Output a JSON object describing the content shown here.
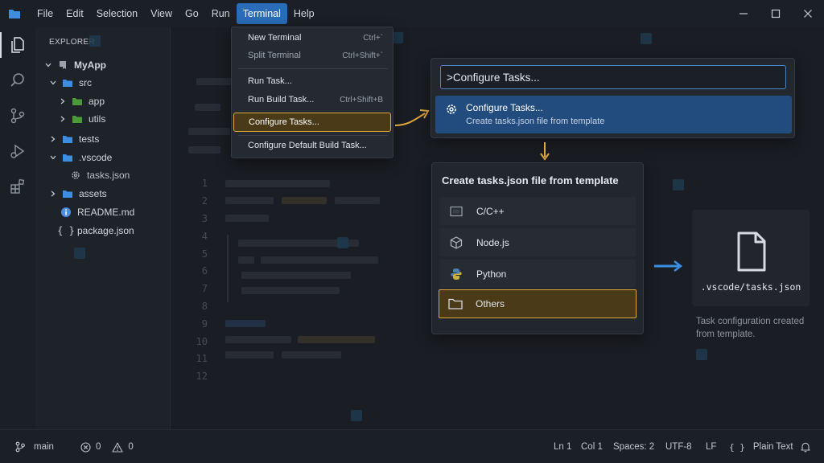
{
  "menubar": {
    "items": [
      "File",
      "Edit",
      "Selection",
      "View",
      "Go",
      "Run",
      "Terminal",
      "Help"
    ],
    "active": "Terminal"
  },
  "sidebar": {
    "header": "EXPLORER",
    "tree": [
      {
        "label": "MyApp",
        "icon": "repo-icon",
        "expanded": true
      },
      {
        "label": "src",
        "icon": "folder-icon",
        "expanded": true
      },
      {
        "label": "app",
        "icon": "folder-icon",
        "expanded": false
      },
      {
        "label": "utils",
        "icon": "folder-icon",
        "expanded": false
      },
      {
        "label": "tests",
        "icon": "folder-icon",
        "expanded": false
      },
      {
        "label": ".vscode",
        "icon": "folder-icon",
        "expanded": true
      },
      {
        "label": "tasks.json",
        "icon": "gear-icon"
      },
      {
        "label": "assets",
        "icon": "folder-icon",
        "expanded": false
      },
      {
        "label": "README.md",
        "icon": "info-icon"
      },
      {
        "label": "package.json",
        "icon": "braces-icon"
      }
    ]
  },
  "editor": {
    "line_numbers": [
      "1",
      "2",
      "3",
      "4",
      "5",
      "6",
      "7",
      "8",
      "9",
      "10",
      "11",
      "12"
    ]
  },
  "terminal_menu": {
    "items": [
      {
        "label": "New Terminal",
        "shortcut": "Ctrl+`"
      },
      {
        "label": "Split Terminal",
        "shortcut": "Ctrl+Shift+`"
      },
      {
        "label": "Run Task...",
        "shortcut": ""
      },
      {
        "label": "Run Build Task...",
        "shortcut": "Ctrl+Shift+B"
      },
      {
        "label": "Configure Tasks...",
        "shortcut": ""
      },
      {
        "label": "Configure Default Build Task...",
        "shortcut": ""
      }
    ]
  },
  "command_palette": {
    "input_value": ">Configure Tasks...",
    "result_title": "Configure Tasks...",
    "result_description": "Create tasks.json file from template"
  },
  "template_picker": {
    "title": "Create tasks.json file from template",
    "options": [
      {
        "label": "C/C++",
        "icon": "chip-icon"
      },
      {
        "label": "Node.js",
        "icon": "cube-icon"
      },
      {
        "label": "Python",
        "icon": "python-icon"
      },
      {
        "label": "Others",
        "icon": "folder-icon"
      }
    ],
    "selected": "Others"
  },
  "result": {
    "file_label": ".vscode/tasks.json",
    "note": "Task configuration created from template."
  },
  "statusbar": {
    "branch": "main",
    "errors": "0",
    "warnings": "0",
    "position_line": "Ln 1",
    "position_col": "Col 1",
    "spaces": "Spaces: 2",
    "encoding": "UTF-8",
    "eol": "LF",
    "language": "Plain Text"
  },
  "colors": {
    "accent": "#2b6cb8",
    "highlight_border": "#e0a93a",
    "arrow_right": "#3a8ee6"
  }
}
